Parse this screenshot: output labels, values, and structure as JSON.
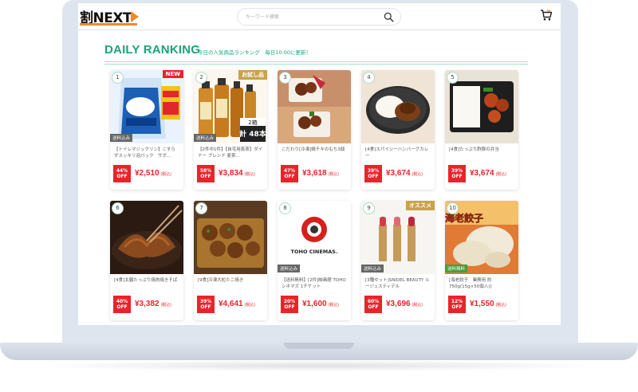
{
  "header": {
    "logo": "割NEXT",
    "search_placeholder": "キーワード検索"
  },
  "section": {
    "title": "DAILY RANKING",
    "subtitle": "今日の人気商品ランキング　毎日10:00に更新！"
  },
  "colors": {
    "accent_green": "#1aa37a",
    "sale_red": "#e8242b",
    "logo_orange": "#f08a24",
    "new_tag": "#e8242b",
    "trial_tag": "#c9a24a"
  },
  "products": [
    {
      "rank": "1",
      "name": "【トイレマジックリン】こすらずスッキリ泡パック　サボ...",
      "discount": "44%",
      "off": "OFF",
      "price": "¥2,510",
      "tax": "(税込)",
      "top_tag": "NEW",
      "shipping_tag": "送料込み"
    },
    {
      "rank": "2",
      "name": "【2件中1件】【自宅用蒸茶】ダイドー ブレンド 麦茶...",
      "discount": "58%",
      "off": "OFF",
      "price": "¥3,834",
      "tax": "(税込)",
      "top_tag": "お試し品",
      "shipping_tag": "送料込み",
      "image_text_a": "2箱",
      "image_text_b": "計 48本"
    },
    {
      "rank": "3",
      "name": "こだわり[冷凍]鶏チキのもち3個",
      "discount": "47%",
      "off": "OFF",
      "price": "¥3,618",
      "tax": "(税込)"
    },
    {
      "rank": "4",
      "name": "[4食]スパイシーハンバーグカレー",
      "discount": "39%",
      "off": "OFF",
      "price": "¥3,674",
      "tax": "(税込)"
    },
    {
      "rank": "5",
      "name": "[4食]たっぷり酢豚の弁当",
      "discount": "39%",
      "off": "OFF",
      "price": "¥3,674",
      "tax": "(税込)"
    },
    {
      "rank": "6",
      "name": "[4食]太麺たっぷり焼肉焼きそば",
      "discount": "40%",
      "off": "OFF",
      "price": "¥3,382",
      "tax": "(税込)"
    },
    {
      "rank": "7",
      "name": "[9食]冷凍大粒たこ焼き",
      "discount": "39%",
      "off": "OFF",
      "price": "¥4,641",
      "tax": "(税込)"
    },
    {
      "rank": "8",
      "name": "【送料無料】[2件]映画館 TOHOシネマズ 1チケット",
      "discount": "20%",
      "off": "OFF",
      "price": "¥1,600",
      "tax": "(税込)",
      "shipping_tag": "送料込み",
      "image_text_a": "TOHO CINEMAS."
    },
    {
      "rank": "9",
      "name": "[3種セット]SNIDEL BEAUTY ルージュスティデル",
      "discount": "60%",
      "off": "OFF",
      "price": "¥3,696",
      "tax": "(税込)",
      "top_tag": "オススメ",
      "shipping_tag": "送料込み"
    },
    {
      "rank": "10",
      "name": "[海老餃子　業務用 約750g(15g×50個入)]",
      "discount": "12%",
      "off": "OFF",
      "price": "¥1,550",
      "tax": "(税込)",
      "shipping_tag": "送料無料",
      "image_text_a": "海老餃子"
    }
  ]
}
